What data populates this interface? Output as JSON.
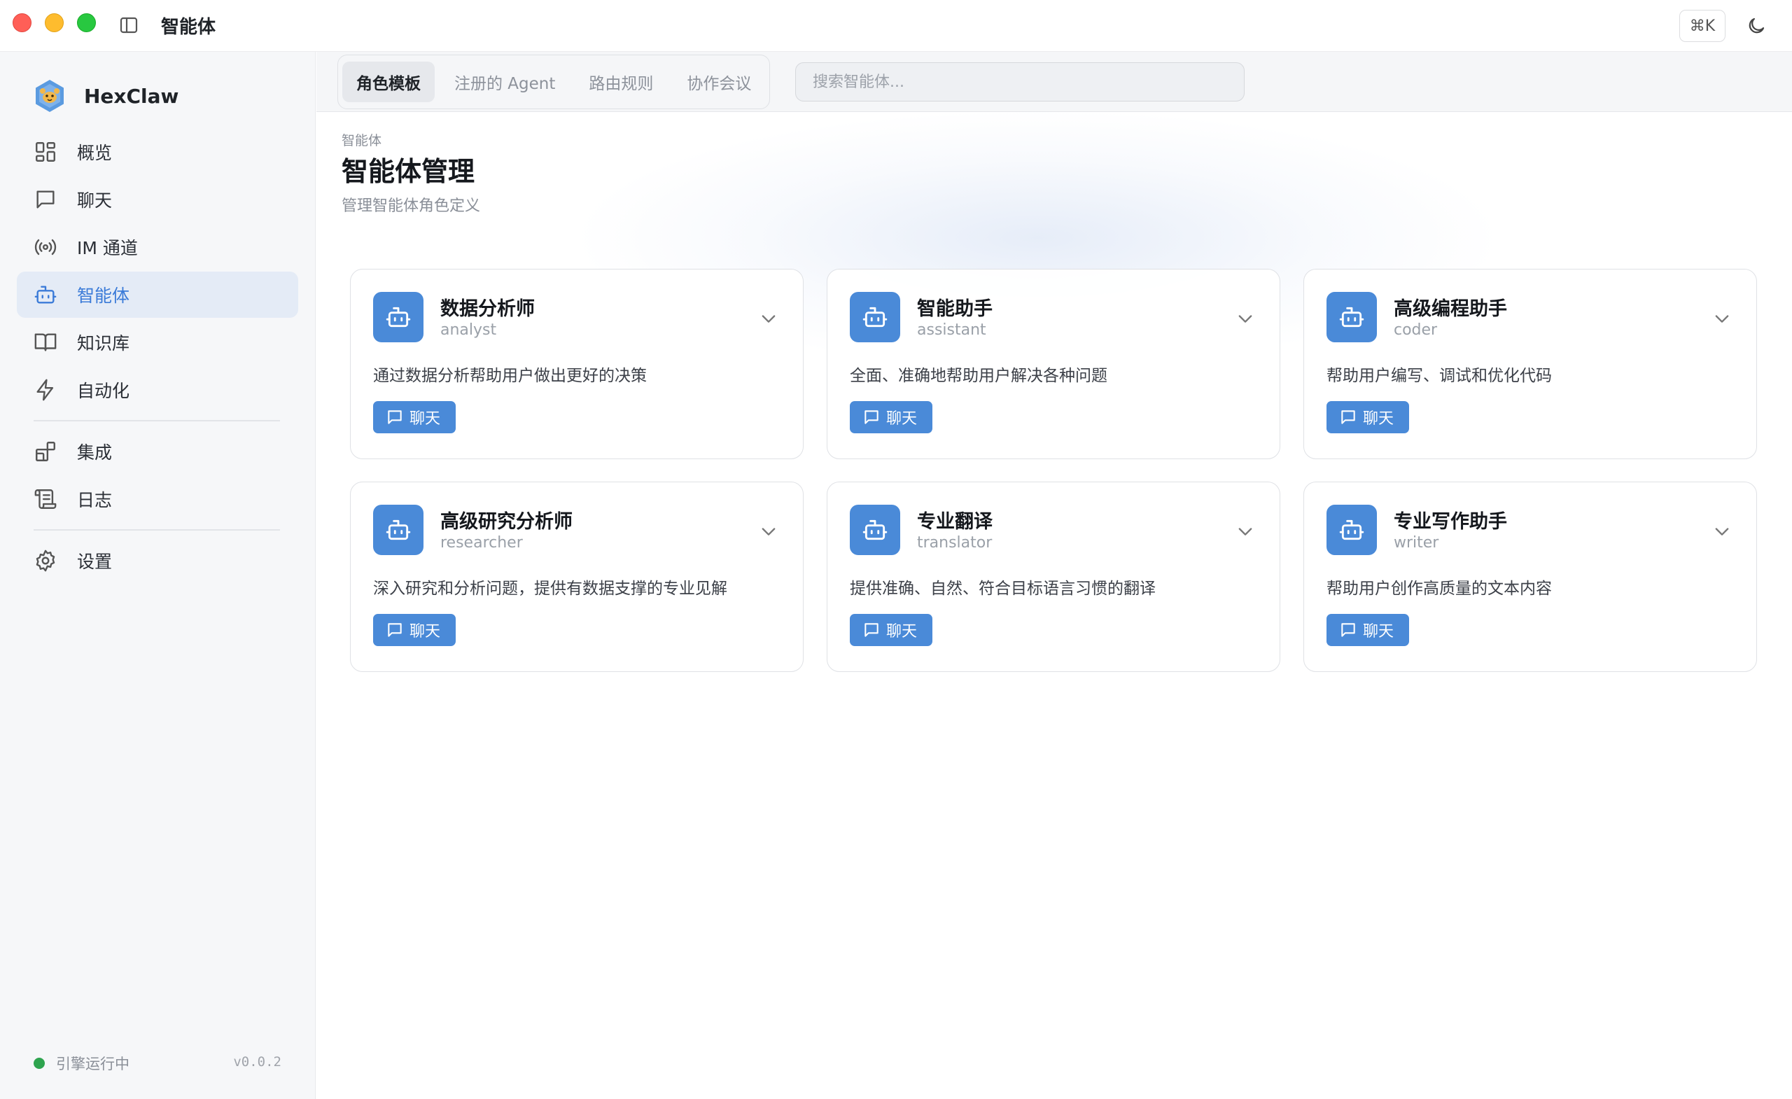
{
  "window": {
    "title": "智能体",
    "shortcut": "⌘K"
  },
  "sidebar": {
    "app_name": "HexClaw",
    "items": [
      {
        "label": "概览",
        "icon": "grid-icon"
      },
      {
        "label": "聊天",
        "icon": "chat-icon"
      },
      {
        "label": "IM 通道",
        "icon": "broadcast-icon"
      },
      {
        "label": "智能体",
        "icon": "robot-icon",
        "active": true
      },
      {
        "label": "知识库",
        "icon": "book-icon"
      },
      {
        "label": "自动化",
        "icon": "lightning-icon"
      },
      {
        "label": "集成",
        "icon": "puzzle-icon"
      },
      {
        "label": "日志",
        "icon": "scroll-icon"
      },
      {
        "label": "设置",
        "icon": "gear-icon"
      }
    ],
    "status": "引擎运行中",
    "version": "v0.0.2"
  },
  "tabs": [
    {
      "label": "角色模板",
      "active": true
    },
    {
      "label": "注册的 Agent"
    },
    {
      "label": "路由规则"
    },
    {
      "label": "协作会议"
    }
  ],
  "search": {
    "placeholder": "搜索智能体..."
  },
  "page": {
    "breadcrumb": "智能体",
    "title": "智能体管理",
    "subtitle": "管理智能体角色定义"
  },
  "cards": [
    {
      "name": "数据分析师",
      "id": "analyst",
      "desc": "通过数据分析帮助用户做出更好的决策",
      "button": "聊天"
    },
    {
      "name": "智能助手",
      "id": "assistant",
      "desc": "全面、准确地帮助用户解决各种问题",
      "button": "聊天"
    },
    {
      "name": "高级编程助手",
      "id": "coder",
      "desc": "帮助用户编写、调试和优化代码",
      "button": "聊天"
    },
    {
      "name": "高级研究分析师",
      "id": "researcher",
      "desc": "深入研究和分析问题，提供有数据支撑的专业见解",
      "button": "聊天"
    },
    {
      "name": "专业翻译",
      "id": "translator",
      "desc": "提供准确、自然、符合目标语言习惯的翻译",
      "button": "聊天"
    },
    {
      "name": "专业写作助手",
      "id": "writer",
      "desc": "帮助用户创作高质量的文本内容",
      "button": "聊天"
    }
  ],
  "colors": {
    "accent": "#4a8ad8",
    "active_nav_bg": "#e4ebf6",
    "status_green": "#2ea44f"
  }
}
